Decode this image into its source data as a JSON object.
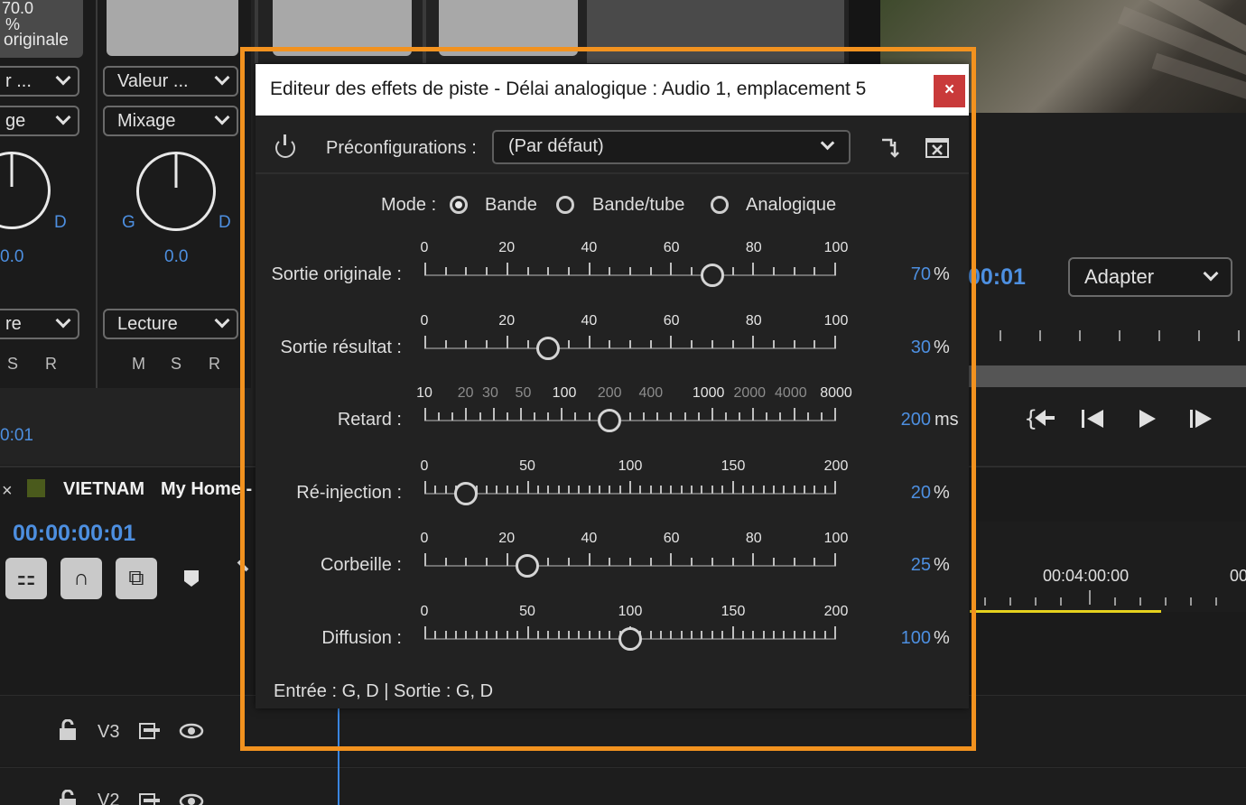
{
  "background": {
    "mixer": {
      "percent_top": "70.0",
      "percent_sign": "%",
      "original_label": "originale",
      "col1": {
        "dd1": "r ...",
        "dd2": "ge",
        "knob_right": "D",
        "value": "0.0",
        "read": "re",
        "msr": [
          "S",
          "R"
        ],
        "time": "0:01"
      },
      "col2": {
        "dd1": "Valeur ...",
        "dd2": "Mixage",
        "knob_left": "G",
        "knob_right": "D",
        "value": "0.0",
        "read": "Lecture",
        "msr": [
          "M",
          "S",
          "R"
        ]
      }
    },
    "monitor": {
      "timecode": "00:01",
      "fit": "Adapter",
      "transport": [
        "go-to-in-icon",
        "step-back-icon",
        "play-icon",
        "step-forward-icon"
      ]
    },
    "timeline": {
      "close_x": "×",
      "tabs": [
        "VIETNAM",
        "My Home -"
      ],
      "timecode": "00:00:00:01",
      "ruler_time": "00:04:00:00",
      "ruler_time2": "00",
      "tracks": [
        {
          "name": "V3"
        },
        {
          "name": "V2"
        }
      ]
    }
  },
  "dialog": {
    "title": "Editeur des effets de piste - Délai analogique : Audio 1, emplacement 5",
    "close_label": "×",
    "presets_label": "Préconfigurations :",
    "preset_value": "(Par défaut)",
    "mode": {
      "label": "Mode :",
      "options": [
        "Bande",
        "Bande/tube",
        "Analogique"
      ],
      "selected": "Bande"
    },
    "params": [
      {
        "label": "Sortie originale :",
        "scale": [
          "0",
          "20",
          "40",
          "60",
          "80",
          "100"
        ],
        "value": "70",
        "unit": "%",
        "fraction": 0.7
      },
      {
        "label": "Sortie résultat :",
        "scale": [
          "0",
          "20",
          "40",
          "60",
          "80",
          "100"
        ],
        "value": "30",
        "unit": "%",
        "fraction": 0.3
      },
      {
        "label": "Retard :",
        "scale": [
          "10",
          "20",
          "30",
          "50",
          "100",
          "200",
          "400",
          "1000",
          "2000",
          "4000",
          "8000"
        ],
        "value": "200",
        "unit": "ms",
        "fraction": 0.45
      },
      {
        "label": "Ré-injection :",
        "scale": [
          "0",
          "50",
          "100",
          "150",
          "200"
        ],
        "value": "20",
        "unit": "%",
        "fraction": 0.1
      },
      {
        "label": "Corbeille :",
        "scale": [
          "0",
          "20",
          "40",
          "60",
          "80",
          "100"
        ],
        "value": "25",
        "unit": "%",
        "fraction": 0.25
      },
      {
        "label": "Diffusion :",
        "scale": [
          "0",
          "50",
          "100",
          "150",
          "200"
        ],
        "value": "100",
        "unit": "%",
        "fraction": 0.5
      }
    ],
    "io": "Entrée : G, D | Sortie : G, D"
  }
}
